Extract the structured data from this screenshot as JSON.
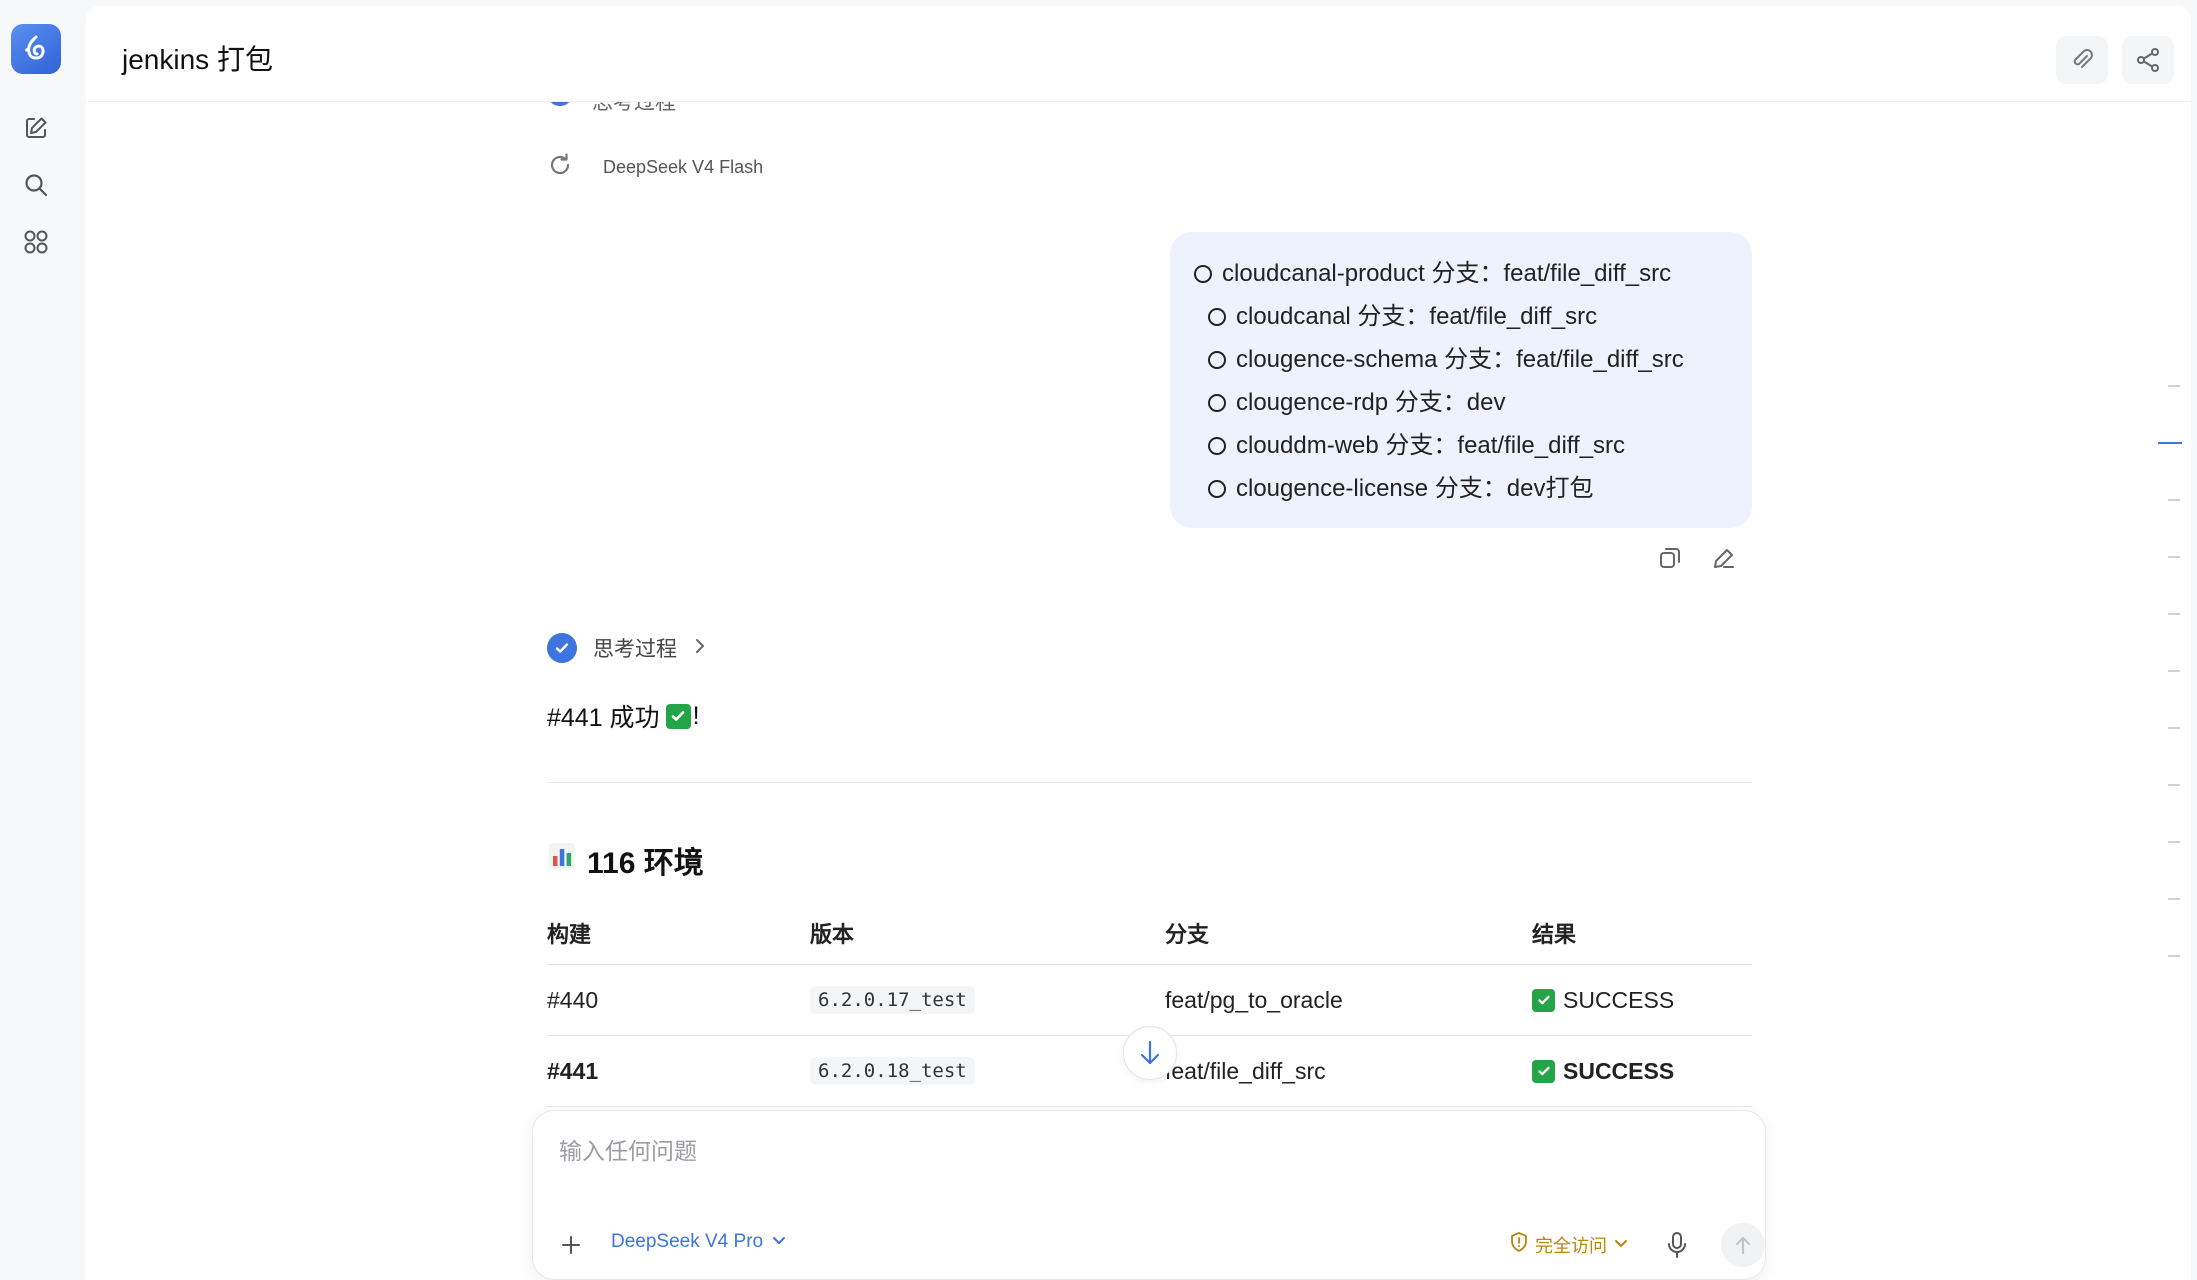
{
  "header": {
    "title": "jenkins 打包"
  },
  "icons": {
    "logo": "app-logo-icon",
    "new_chat": "edit-icon",
    "search": "search-icon",
    "apps": "grid-icon",
    "attach": "paperclip-icon",
    "share": "share-icon"
  },
  "conversation": {
    "regen_model": "DeepSeek V4 Flash",
    "user_message": {
      "first_line": "cloudcanal-product 分支：feat/file_diff_src",
      "sub_items": [
        "cloudcanal 分支：feat/file_diff_src",
        "clougence-schema 分支：feat/file_diff_src",
        "clougence-rdp 分支：dev",
        "clouddm-web 分支：feat/file_diff_src",
        "clougence-license 分支：dev打包"
      ]
    },
    "thinking_label": "思考过程",
    "result_prefix": "#441 成功",
    "result_suffix": "!",
    "section_title": "116 环境",
    "table": {
      "headers": [
        "构建",
        "版本",
        "分支",
        "结果"
      ],
      "rows": [
        {
          "build": "#440",
          "version": "6.2.0.17_test",
          "branch": "feat/pg_to_oracle",
          "result": "SUCCESS"
        },
        {
          "build": "#441",
          "version": "6.2.0.18_test",
          "branch": "feat/file_diff_src",
          "result": "SUCCESS"
        }
      ]
    }
  },
  "composer": {
    "placeholder": "输入任何问题",
    "model": "DeepSeek V4 Pro",
    "access": "完全访问"
  },
  "colors": {
    "accent": "#3d74de",
    "success": "#22a447",
    "access": "#b8860b",
    "bubble": "#eef2fc"
  }
}
